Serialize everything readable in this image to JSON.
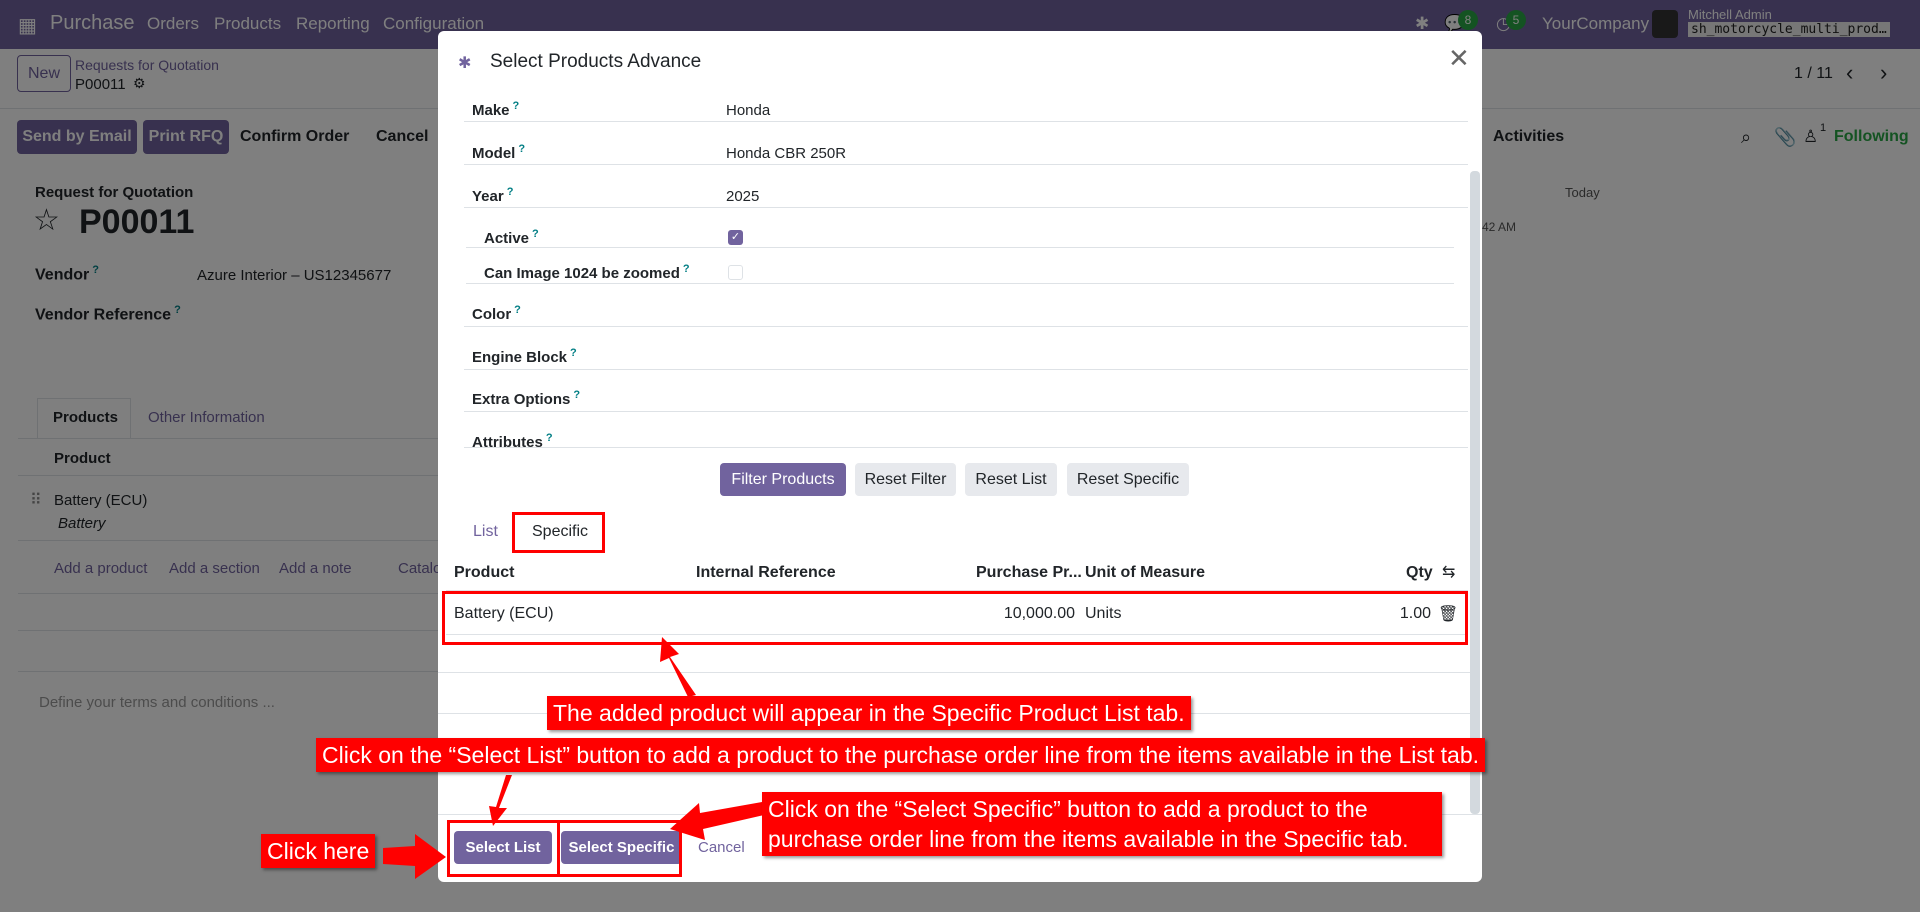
{
  "navbar": {
    "app": "Purchase",
    "menus": [
      "Orders",
      "Products",
      "Reporting",
      "Configuration"
    ],
    "messages_count": "8",
    "activities_count": "5",
    "company": "YourCompany",
    "user": "Mitchell Admin",
    "database": "sh_motorcycle_multi_prod…"
  },
  "control": {
    "new": "New",
    "breadcrumb": "Requests for Quotation",
    "record": "P00011",
    "pager": "1 / 11"
  },
  "actions": {
    "send_email": "Send by Email",
    "print_rfq": "Print RFQ",
    "confirm": "Confirm Order",
    "cancel": "Cancel"
  },
  "chatter": {
    "activities": "Activities",
    "followers_count": "1",
    "following": "Following",
    "today": "Today",
    "time": "42 AM"
  },
  "form": {
    "subtitle": "Request for Quotation",
    "title": "P00011",
    "vendor_label": "Vendor",
    "vendor_value": "Azure Interior – US12345677",
    "vendor_ref_label": "Vendor Reference",
    "tabs": [
      "Products",
      "Other Information"
    ],
    "product_header": "Product",
    "line_product": "Battery (ECU)",
    "line_desc": "Battery",
    "add_product": "Add a product",
    "add_section": "Add a section",
    "add_note": "Add a note",
    "catalog": "Catalog",
    "terms_placeholder": "Define your terms and conditions ..."
  },
  "modal": {
    "title": "Select Products Advance",
    "fields": [
      {
        "label": "Make",
        "value": "Honda"
      },
      {
        "label": "Model",
        "value": "Honda CBR 250R"
      },
      {
        "label": "Year",
        "value": "2025"
      },
      {
        "label": "Active",
        "checked": true
      },
      {
        "label": "Can Image 1024 be zoomed",
        "checked": false
      },
      {
        "label": "Color",
        "value": ""
      },
      {
        "label": "Engine Block",
        "value": ""
      },
      {
        "label": "Extra Options",
        "value": ""
      },
      {
        "label": "Attributes",
        "value": ""
      }
    ],
    "buttons": {
      "filter": "Filter Products",
      "reset_filter": "Reset Filter",
      "reset_list": "Reset List",
      "reset_specific": "Reset Specific"
    },
    "tabs": [
      "List",
      "Specific"
    ],
    "columns": [
      "Product",
      "Internal Reference",
      "Purchase Pr...",
      "Unit of Measure",
      "Qty"
    ],
    "rows": [
      {
        "product": "Battery (ECU)",
        "ref": "",
        "price": "10,000.00",
        "uom": "Units",
        "qty": "1.00"
      }
    ],
    "footer": {
      "select_list": "Select List",
      "select_specific": "Select Specific",
      "cancel": "Cancel"
    }
  },
  "annotations": {
    "added": "The added product will appear in the Specific Product List tab.",
    "select_list": "Click on the “Select List” button to add a product to the purchase order line from the items available in the List tab.",
    "select_specific_1": "Click on the “Select Specific” button to add a product to the",
    "select_specific_2": "purchase order line from the items available in the Specific tab.",
    "click_here": "Click here"
  },
  "colors": {
    "primary": "#71639e",
    "annotation": "#ff0000",
    "following": "#28a745"
  }
}
